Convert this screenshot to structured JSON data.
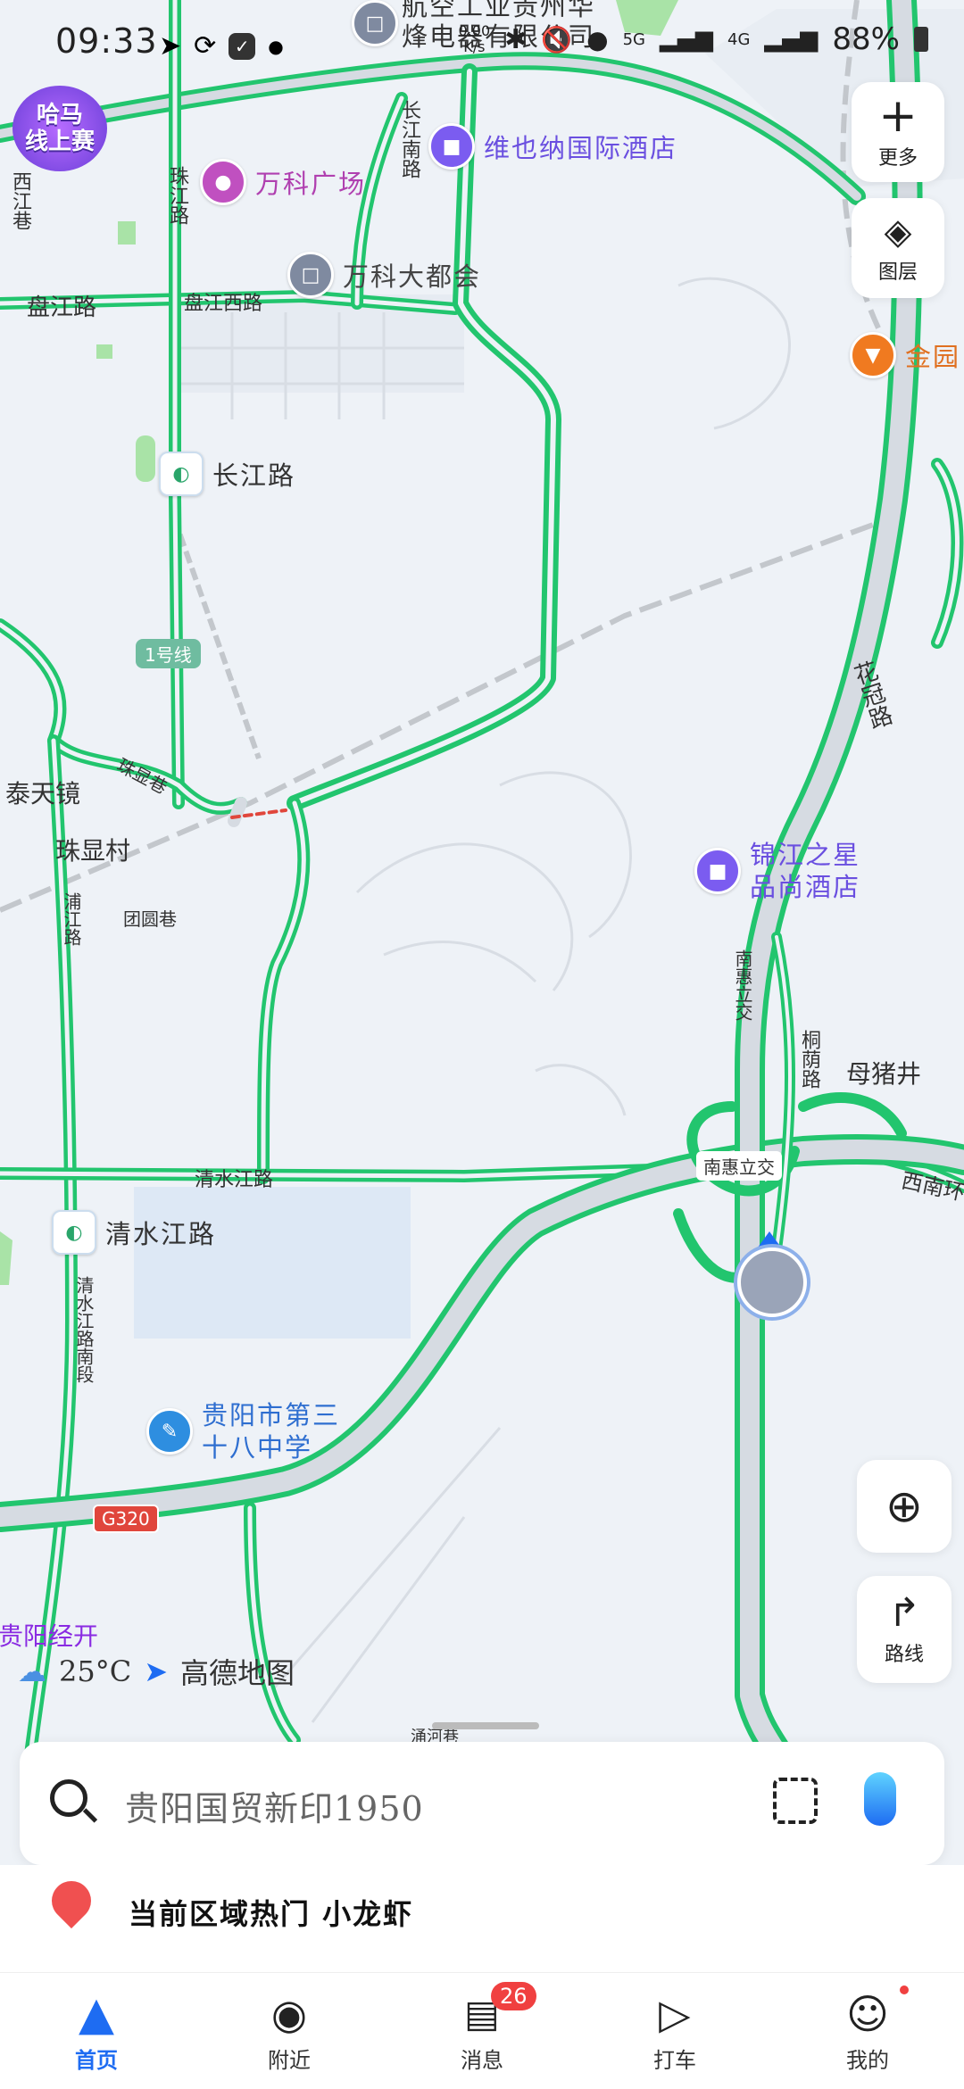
{
  "status_bar": {
    "time": "09:33",
    "net_speed_value": "0.00",
    "net_speed_unit": "K/s",
    "network_5g": "5G",
    "network_4g": "4G",
    "battery": "88%"
  },
  "map_controls": {
    "more_label": "更多",
    "layers_label": "图层",
    "route_label": "路线"
  },
  "promo": {
    "badge_line1": "哈马",
    "badge_line2": "线上赛"
  },
  "map_labels": {
    "road_xijiang": "西江巷",
    "road_zhujiang": "珠江路",
    "road_changjiang_south": "长江南路",
    "road_panjiang": "盘江路",
    "road_panjiang_west": "盘江西路",
    "road_zhuxian": "珠显巷",
    "road_puyang": "浦江路",
    "road_tuanyuan": "团圆巷",
    "road_qingshui": "清水江路",
    "road_qingshui_south": "清水江路南段",
    "road_huaguan": "花冠路",
    "road_nanhui_overpass": "南惠立交",
    "road_tongyin": "桐荫路",
    "road_xinan": "西南环",
    "place_taitianjing": "泰天镜",
    "place_zhuxiancun": "珠显村",
    "place_muzhujing": "母猪井",
    "place_guiyang_jingkai": "贵阳经开",
    "place_yuhe": "涌河巷",
    "metro_line": "1号线",
    "highway_shield": "G320",
    "poi_top": "航空工业贵州华烽电器有限公司",
    "poi_jinyuan": "金园"
  },
  "pois": {
    "weiyena": "维也纳国际酒店",
    "wanke_plaza": "万科广场",
    "wanke_dadu": "万科大都会",
    "jinjiang_line1": "锦江之星",
    "jinjiang_line2": "品尚酒店",
    "school_line1": "贵阳市第三",
    "school_line2": "十八中学",
    "metro_changjiang": "长江路",
    "metro_qingshui": "清水江路"
  },
  "weather": {
    "temp": "25°C",
    "brand": "高德地图"
  },
  "search": {
    "placeholder": "贵阳国贸新印1950"
  },
  "hot": {
    "text": "当前区域热门 小龙虾"
  },
  "tabs": [
    {
      "label": "首页"
    },
    {
      "label": "附近"
    },
    {
      "label": "消息",
      "badge": "26"
    },
    {
      "label": "打车"
    },
    {
      "label": "我的"
    }
  ],
  "colors": {
    "road_green": "#22c56e",
    "road_grey": "#d6dbe2",
    "accent_blue": "#1e6cf2",
    "badge_red": "#f04040",
    "poi_purple": "#7b5cf0"
  }
}
